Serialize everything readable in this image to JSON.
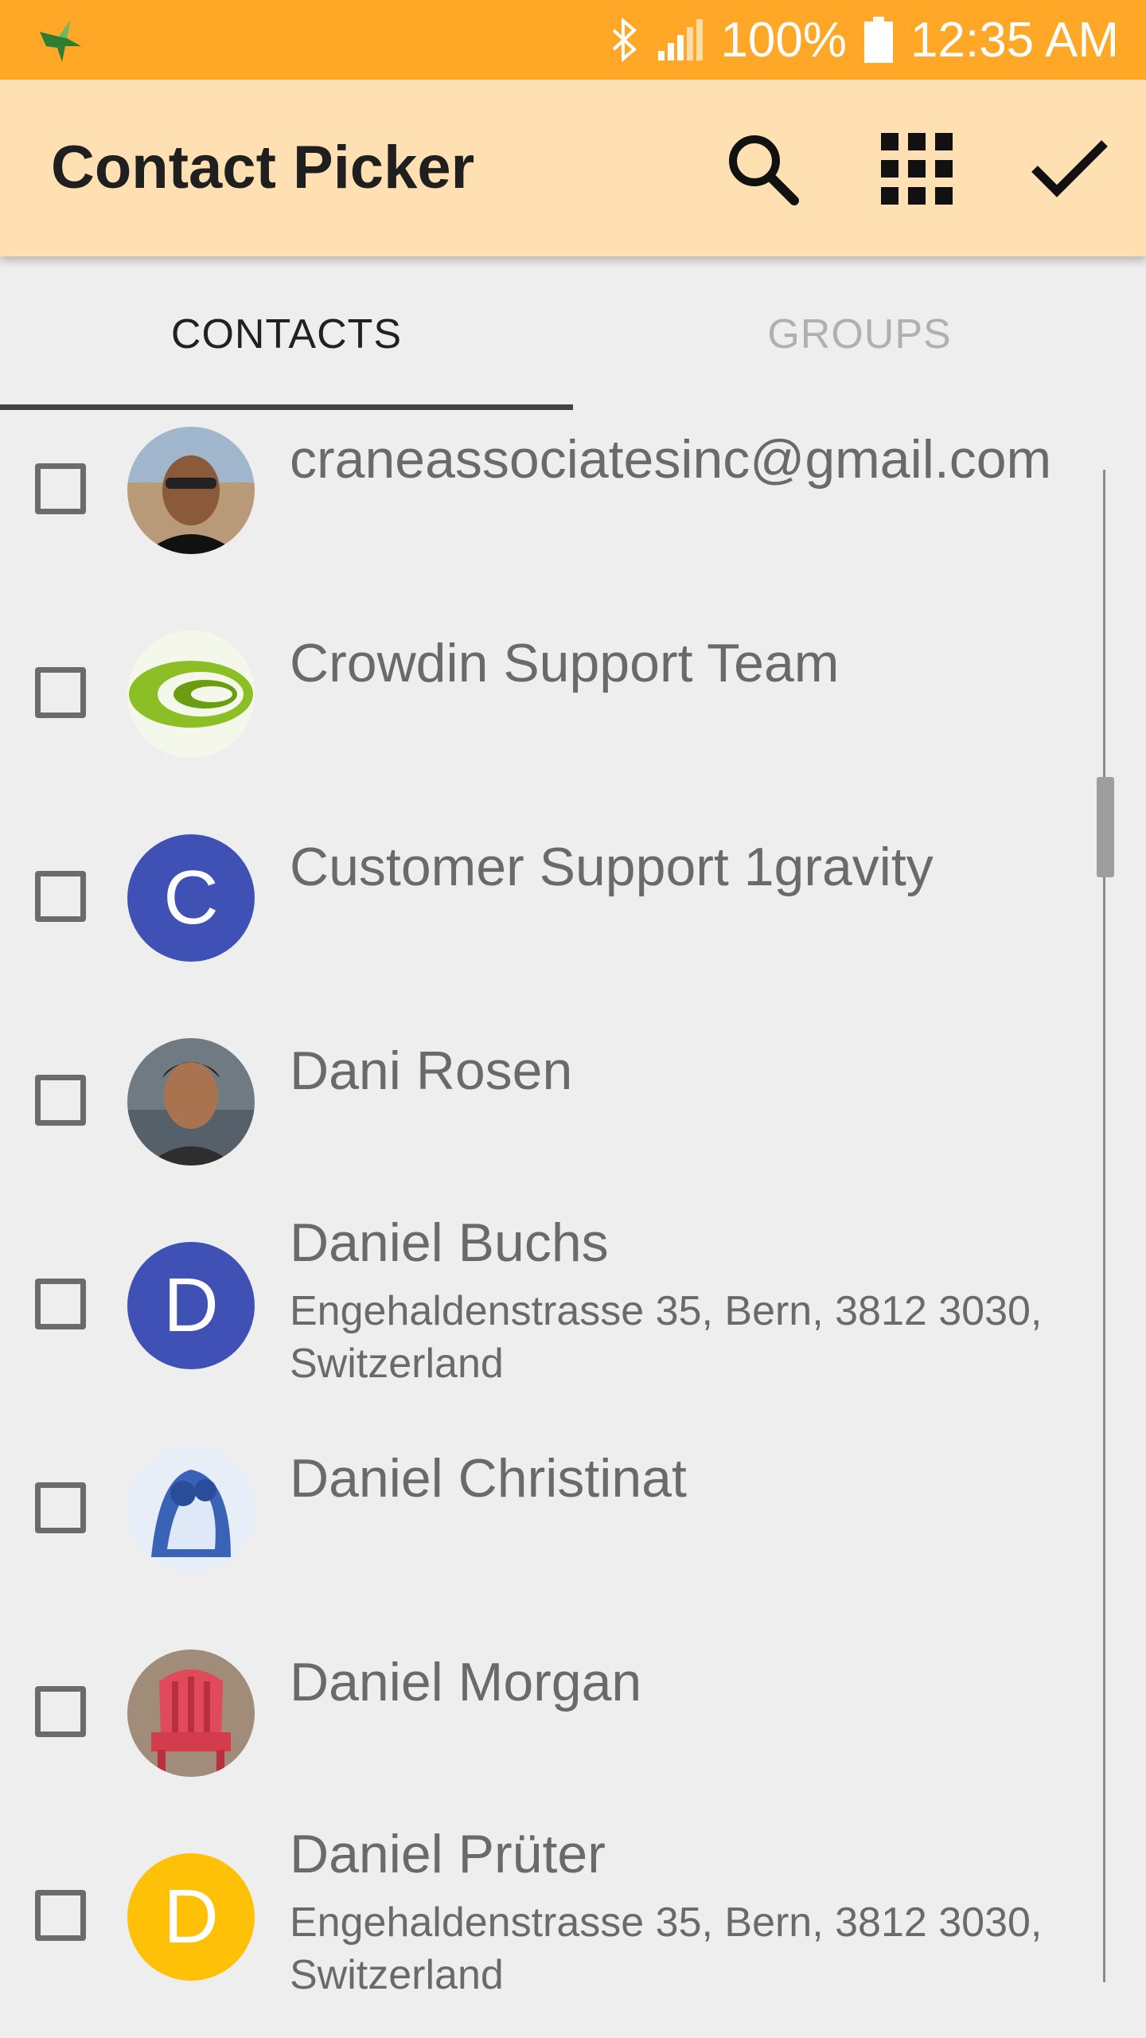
{
  "status_bar": {
    "battery": "100%",
    "time": "12:35 AM",
    "app_icon": "hummingbird-icon",
    "bluetooth_icon": "bluetooth-icon",
    "signal_icon": "signal-icon",
    "battery_icon": "battery-icon",
    "color": "#ffa726"
  },
  "app_bar": {
    "title": "Contact Picker",
    "actions": [
      "search-icon",
      "grid-icon",
      "check-icon"
    ],
    "color": "#ffe0b2"
  },
  "tabs": [
    {
      "label": "CONTACTS",
      "active": true
    },
    {
      "label": "GROUPS",
      "active": false
    }
  ],
  "contacts": [
    {
      "name": "craneassociatesinc@gmail.com",
      "subtitle": "",
      "avatar": "photo",
      "checked": false
    },
    {
      "name": "Crowdin Support Team",
      "subtitle": "",
      "avatar": "logo",
      "checked": false
    },
    {
      "name": "Customer Support 1gravity",
      "subtitle": "",
      "avatar": "letter",
      "letter": "C",
      "avatar_color": "#3f51b5",
      "checked": false
    },
    {
      "name": "Dani Rosen",
      "subtitle": "",
      "avatar": "photo",
      "checked": false
    },
    {
      "name": "Daniel Buchs",
      "subtitle": "Engehaldenstrasse 35, Bern, 3812 3030, Switzerland",
      "avatar": "letter",
      "letter": "D",
      "avatar_color": "#3f51b5",
      "checked": false
    },
    {
      "name": "Daniel Christinat",
      "subtitle": "",
      "avatar": "photo",
      "checked": false
    },
    {
      "name": "Daniel Morgan",
      "subtitle": "",
      "avatar": "photo",
      "checked": false
    },
    {
      "name": "Daniel Prüter",
      "subtitle": "Engehaldenstrasse 35, Bern, 3812 3030, Switzerland",
      "avatar": "letter",
      "letter": "D",
      "avatar_color": "#ffc107",
      "checked": false
    }
  ]
}
